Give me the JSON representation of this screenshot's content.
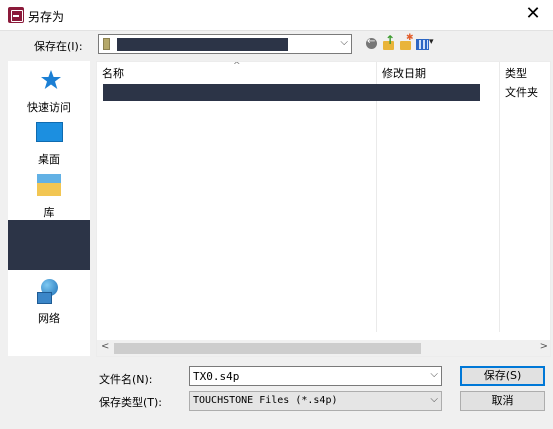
{
  "window": {
    "title": "另存为",
    "close_glyph": "✕"
  },
  "toolbar": {
    "save_in_label": "保存在(I):",
    "combo_arrow": "⌵"
  },
  "places": [
    {
      "id": "quick-access",
      "label": "快速访问",
      "icon": "star-icon"
    },
    {
      "id": "desktop",
      "label": "桌面",
      "icon": "desktop-icon"
    },
    {
      "id": "libraries",
      "label": "库",
      "icon": "library-icon"
    },
    {
      "id": "this-pc",
      "label": "",
      "icon": "redacted"
    },
    {
      "id": "network",
      "label": "网络",
      "icon": "network-icon"
    }
  ],
  "file_list": {
    "columns": [
      "名称",
      "修改日期",
      "类型"
    ],
    "rows": [
      {
        "name": "",
        "date": "",
        "type": "文件夹"
      }
    ]
  },
  "scroll": {
    "left": "<",
    "right": ">"
  },
  "footer": {
    "file_name_label": "文件名(N):",
    "file_name_value": "TX0.s4p",
    "file_type_label": "保存类型(T):",
    "file_type_value": "TOUCHSTONE Files (*.s4p)",
    "save_button": "保存(S)",
    "cancel_button": "取消"
  },
  "colors": {
    "accent": "#0078d7",
    "redaction": "#2c3447"
  }
}
